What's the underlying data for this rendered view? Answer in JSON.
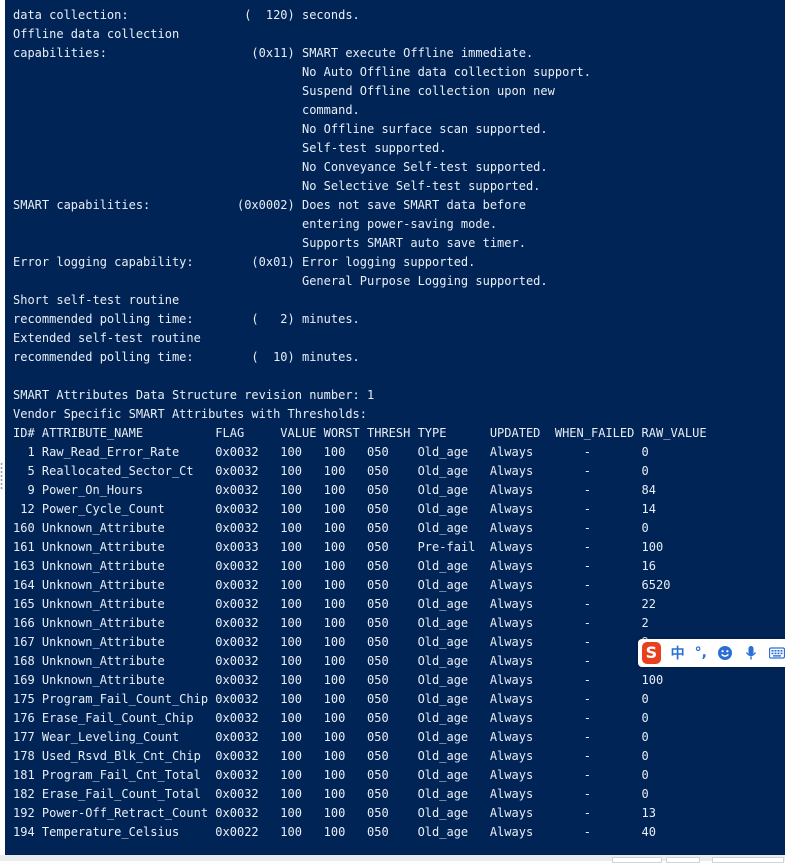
{
  "terminal": {
    "lines": [
      "data collection:                (  120) seconds.",
      "Offline data collection",
      "capabilities:                    (0x11) SMART execute Offline immediate.",
      "                                        No Auto Offline data collection support.",
      "                                        Suspend Offline collection upon new",
      "                                        command.",
      "                                        No Offline surface scan supported.",
      "                                        Self-test supported.",
      "                                        No Conveyance Self-test supported.",
      "                                        No Selective Self-test supported.",
      "SMART capabilities:            (0x0002) Does not save SMART data before",
      "                                        entering power-saving mode.",
      "                                        Supports SMART auto save timer.",
      "Error logging capability:        (0x01) Error logging supported.",
      "                                        General Purpose Logging supported.",
      "Short self-test routine",
      "recommended polling time:        (   2) minutes.",
      "Extended self-test routine",
      "recommended polling time:        (  10) minutes.",
      "",
      "SMART Attributes Data Structure revision number: 1",
      "Vendor Specific SMART Attributes with Thresholds:",
      "ID# ATTRIBUTE_NAME          FLAG     VALUE WORST THRESH TYPE      UPDATED  WHEN_FAILED RAW_VALUE",
      "  1 Raw_Read_Error_Rate     0x0032   100   100   050    Old_age   Always       -       0",
      "  5 Reallocated_Sector_Ct   0x0032   100   100   050    Old_age   Always       -       0",
      "  9 Power_On_Hours          0x0032   100   100   050    Old_age   Always       -       84",
      " 12 Power_Cycle_Count       0x0032   100   100   050    Old_age   Always       -       14",
      "160 Unknown_Attribute       0x0032   100   100   050    Old_age   Always       -       0",
      "161 Unknown_Attribute       0x0033   100   100   050    Pre-fail  Always       -       100",
      "163 Unknown_Attribute       0x0032   100   100   050    Old_age   Always       -       16",
      "164 Unknown_Attribute       0x0032   100   100   050    Old_age   Always       -       6520",
      "165 Unknown_Attribute       0x0032   100   100   050    Old_age   Always       -       22",
      "166 Unknown_Attribute       0x0032   100   100   050    Old_age   Always       -       2",
      "167 Unknown_Attribute       0x0032   100   100   050    Old_age   Always       -       9",
      "168 Unknown_Attribute       0x0032   100   100   050    Old_age   Always       -       150",
      "169 Unknown_Attribute       0x0032   100   100   050    Old_age   Always       -       100",
      "175 Program_Fail_Count_Chip 0x0032   100   100   050    Old_age   Always       -       0",
      "176 Erase_Fail_Count_Chip   0x0032   100   100   050    Old_age   Always       -       0",
      "177 Wear_Leveling_Count     0x0032   100   100   050    Old_age   Always       -       0",
      "178 Used_Rsvd_Blk_Cnt_Chip  0x0032   100   100   050    Old_age   Always       -       0",
      "181 Program_Fail_Cnt_Total  0x0032   100   100   050    Old_age   Always       -       0",
      "182 Erase_Fail_Count_Total  0x0032   100   100   050    Old_age   Always       -       0",
      "192 Power-Off_Retract_Count 0x0032   100   100   050    Old_age   Always       -       13",
      "194 Temperature_Celsius     0x0022   100   100   050    Old_age   Always       -       40"
    ]
  },
  "ime_toolbar": {
    "logo_letter": "S",
    "language": "中",
    "punctuation": "°,",
    "icons": [
      "emoji-icon",
      "microphone-icon",
      "keyboard-icon"
    ]
  },
  "colors": {
    "terminal_bg": "#012456",
    "terminal_fg": "#e8eef6",
    "ime_brand": "#e8401f",
    "ime_accent": "#2b6fd6"
  }
}
